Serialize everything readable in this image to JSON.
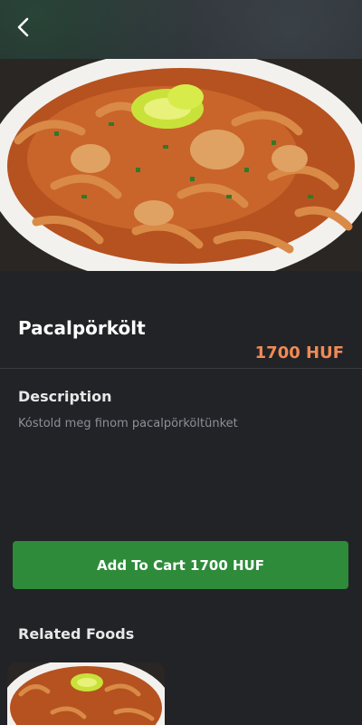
{
  "food": {
    "name": "Pacalpörkölt",
    "price": "1700 HUF"
  },
  "description": {
    "heading": "Description",
    "text": "Kóstold meg finom pacalpörköltünket"
  },
  "cart_button": {
    "label": "Add To Cart 1700 HUF"
  },
  "related": {
    "heading": "Related Foods"
  },
  "icons": {
    "back": "chevron-left-icon"
  },
  "colors": {
    "background": "#222327",
    "price": "#f08a55",
    "cart_button": "#2e8b3a",
    "muted_text": "#8e8f95"
  }
}
